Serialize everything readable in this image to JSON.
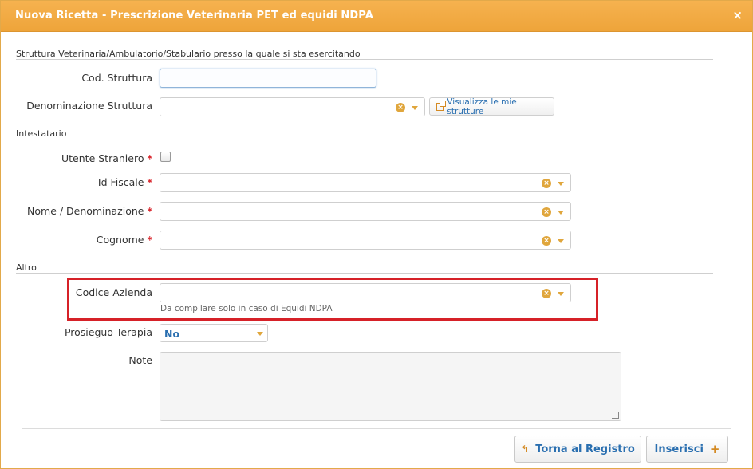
{
  "dialog": {
    "title": "Nuova Ricetta - Prescrizione Veterinaria PET ed equidi NDPA",
    "close_icon": "×"
  },
  "sections": {
    "struttura": "Struttura Veterinaria/Ambulatorio/Stabulario presso la quale si sta esercitando",
    "intestatario": "Intestatario",
    "altro": "Altro"
  },
  "fields": {
    "cod_struttura": {
      "label": "Cod. Struttura",
      "value": ""
    },
    "denominazione_struttura": {
      "label": "Denominazione Struttura",
      "value": ""
    },
    "visualizza_button": "Visualizza le mie strutture",
    "utente_straniero": {
      "label": "Utente Straniero",
      "checked": false
    },
    "id_fiscale": {
      "label": "Id Fiscale",
      "value": ""
    },
    "nome_denominazione": {
      "label": "Nome / Denominazione",
      "value": ""
    },
    "cognome": {
      "label": "Cognome",
      "value": ""
    },
    "codice_azienda": {
      "label": "Codice Azienda",
      "value": "",
      "hint": "Da compilare solo in caso di Equidi NDPA"
    },
    "prosieguo_terapia": {
      "label": "Prosieguo Terapia",
      "selected": "No"
    },
    "note": {
      "label": "Note",
      "value": ""
    }
  },
  "required_marker": "*",
  "buttons": {
    "torna_al_registro": "Torna al Registro",
    "inserisci": "Inserisci"
  },
  "colors": {
    "accent": "#eea43a",
    "link": "#2a6fb0",
    "highlight": "#d62128"
  }
}
